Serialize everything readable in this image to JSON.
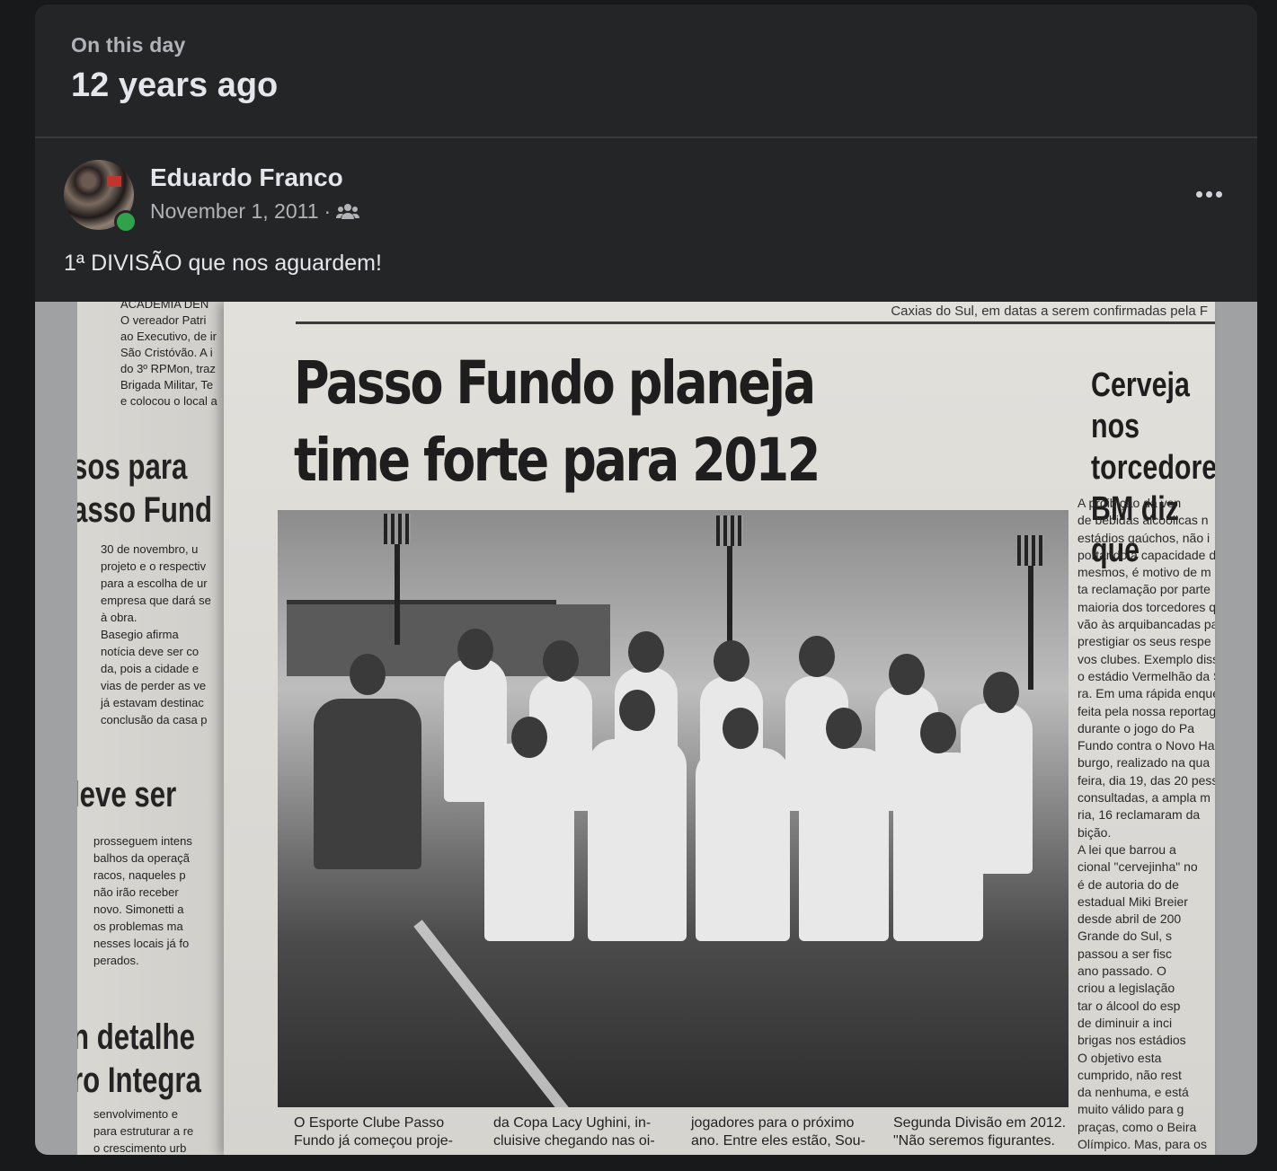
{
  "memory": {
    "label": "On this day",
    "ago": "12 years ago"
  },
  "post": {
    "author": "Eduardo Franco",
    "date": "November 1, 2011",
    "separator": "·",
    "audience_icon": "friends-icon",
    "text": "1ª DIVISÃO que nos aguardem!"
  },
  "photo": {
    "top_line": "Caxias do Sul, em datas a serem confirmadas pela F",
    "headline": "Passo Fundo planeja time forte para 2012",
    "left_heading_1": "sos para",
    "left_heading_2": "asso Fund",
    "left_text_1": "30 de novembro, u\nprojeto e o respectiv\npara a escolha de ur\nempresa que dará se\nà obra.\nBasegio afirma\nnotícia deve ser co\nda, pois a cidade e\nvias de perder as ve\njá estavam destinac\nconclusão da casa p",
    "left_heading_3": "leve ser",
    "left_text_2": "prosseguem intens\nbalhos da operaçã\nracos, naqueles p\nnão irão receber\nnovo. Simonetti a\nos problemas ma\nnesses locais já fo\nperados.",
    "left_heading_4": "n detalhe",
    "left_heading_5": "ro Integra",
    "left_top_text": "ACADEMIA DEN\nO vereador Patri\nao Executivo, de ir\nSão Cristóvão. A i\ndo 3º RPMon, traz\nBrigada Militar, Te\ne colocou o local a",
    "right_heading": "Cerveja nos\ntorcedores\nBM diz que",
    "right_text": "A proibição da ven\nde bebidas alcoólicas n\nestádios gaúchos, não i\nportando a capacidade d\nmesmos, é motivo de m\nta reclamação por parte\nmaioria dos torcedores q\nvão às arquibancadas pa\nprestigiar os seus respe\nvos clubes. Exemplo disso\no estádio Vermelhão da S\nra. Em uma rápida enque\nfeita pela nossa reportage\ndurante o jogo do Pa\nFundo contra o Novo Ha\nburgo, realizado na qua\nfeira, dia 19, das 20 pess\nconsultadas, a ampla m\nria, 16 reclamaram da\nbição.\nA lei que barrou a\ncional \"cervejinha\" no\né de autoria do de\nestadual Miki Breier\ndesde abril de 200\nGrande do Sul, s\npassou a ser fisc\nano passado. O\ncriou a legislação\ntar o álcool do esp\nde diminuir a inci\nbrigas nos estádios\nO objetivo esta\ncumprido, não rest\nda nenhuma, e está\nmuito válido para g\npraças, como o Beira\nOlímpico. Mas, para os\nno interior, de clubes f",
    "caption_col_1": "O Esporte Clube Passo\nFundo já começou proje-",
    "caption_col_2": "da Copa Lacy Ughini, in-\ncluisive chegando nas oi-",
    "caption_col_3": "jogadores para o próximo\nano. Entre eles estão, Sou-",
    "caption_col_4": "Segunda Divisão em 2012.\n\"Não seremos figurantes.",
    "left_bottom_text": "senvolvimento e\npara estruturar a re\no crescimento urb"
  }
}
